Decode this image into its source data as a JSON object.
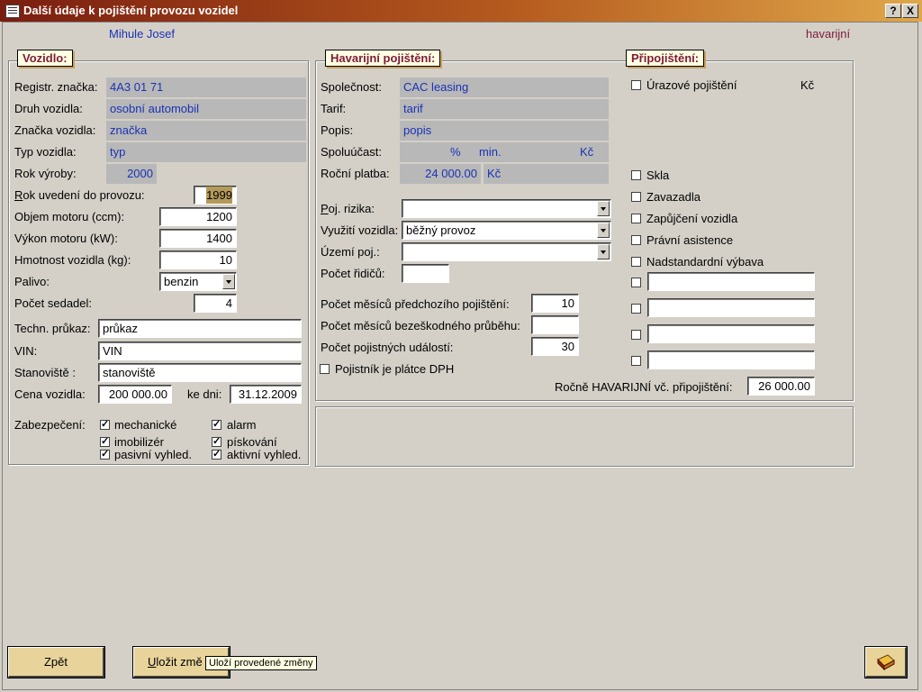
{
  "window": {
    "title": "Další údaje k pojištění provozu vozidel",
    "help": "?",
    "close": "X"
  },
  "header": {
    "client_name": "Mihule Josef",
    "insurance_type": "havarijní"
  },
  "vehicle": {
    "title": "Vozidlo:",
    "reg_label": "Registr. značka:",
    "reg_value": "4A3 01 71",
    "kind_label": "Druh vozidla:",
    "kind_value": "osobní automobil",
    "brand_label": "Značka vozidla:",
    "brand_value": "značka",
    "type_label": "Typ vozidla:",
    "type_value": "typ",
    "year_label": "Rok výroby:",
    "year_value": "2000",
    "service_year_label_first": "R",
    "service_year_label_rest": "ok uvedení do provozu:",
    "service_year_value": "1999",
    "engine_label": "Objem motoru (ccm):",
    "engine_value": "1200",
    "power_label": "Výkon motoru (kW):",
    "power_value": "1400",
    "weight_label": "Hmotnost vozidla (kg):",
    "weight_value": "10",
    "fuel_label": "Palivo:",
    "fuel_value": "benzin",
    "seats_label": "Počet sedadel:",
    "seats_value": "4",
    "tp_label": "Techn. průkaz:",
    "tp_value": "průkaz",
    "vin_label": "VIN:",
    "vin_value": "VIN",
    "location_label": "Stanoviště :",
    "location_value": "stanoviště",
    "price_label": "Cena vozidla:",
    "price_value": "200 000.00",
    "date_label": "ke dni:",
    "date_value": "31.12.2009",
    "security_label": "Zabezpečení:",
    "security": [
      {
        "label": "mechanické",
        "checked": true
      },
      {
        "label": "alarm",
        "checked": true
      },
      {
        "label": "imobilizér",
        "checked": true
      },
      {
        "label": "pískování",
        "checked": true
      },
      {
        "label": "pasivní vyhled.",
        "checked": true
      },
      {
        "label": "aktivní vyhled.",
        "checked": true
      }
    ]
  },
  "casco": {
    "title": "Havarijní pojištění:",
    "company_label": "Společnost:",
    "company_value": "CAC leasing",
    "tariff_label": "Tarif:",
    "tariff_value": "tarif",
    "desc_label": "Popis:",
    "desc_value": "popis",
    "deductible_label": "Spoluúčast:",
    "deductible_pct": "%",
    "deductible_min": "min.",
    "deductible_cur": "Kč",
    "annual_label": "Roční platba:",
    "annual_value": "24 000.00",
    "annual_cur": "Kč",
    "risks_label_first": "P",
    "risks_label_rest": "oj. rizika:",
    "risks_value": "",
    "usage_label": "Využití vozidla:",
    "usage_value": "běžný provoz",
    "territory_label": "Území poj.:",
    "territory_value": "",
    "drivers_label": "Počet řidičů:",
    "drivers_value": "",
    "prev_months_label": "Počet měsíců předchozího pojištění:",
    "prev_months_value": "10",
    "claimfree_label": "Počet měsíců bezeškodného průběhu:",
    "claimfree_value": "",
    "claims_label": "Počet pojistných událostí:",
    "claims_value": "30",
    "vat_label": "Pojistník je plátce DPH",
    "vat_checked": false
  },
  "riders": {
    "title": "Připojištění:",
    "accident_label": "Úrazové pojištění",
    "accident_cur": "Kč",
    "items": [
      "Skla",
      "Zavazadla",
      "Zapůjčení vozidla",
      "Právní asistence",
      "Nadstandardní výbava"
    ],
    "extra_fields": [
      "",
      "",
      "",
      ""
    ],
    "total_label": "Ročně HAVARIJNÍ vč. připojištění:",
    "total_value": "26 000.00"
  },
  "footer": {
    "back_label": "Zpět",
    "save_label_first": "U",
    "save_label_rest": "ložit změ",
    "tooltip": "Uloží provedené změny"
  }
}
